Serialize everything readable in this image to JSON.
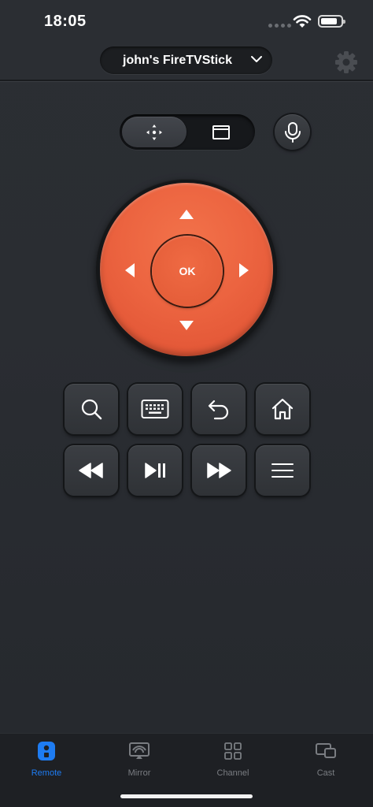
{
  "status_bar": {
    "time": "18:05"
  },
  "header": {
    "device_name": "john's FireTVStick",
    "icons": {
      "chevron": "chevron-down-icon",
      "settings": "gear-icon"
    }
  },
  "mode_toggle": {
    "selected": "dpad",
    "options": [
      "dpad",
      "touchpad"
    ]
  },
  "dpad": {
    "ok_label": "OK",
    "color": "#ec6440"
  },
  "controls": {
    "row1": [
      "search",
      "keyboard",
      "back",
      "home"
    ],
    "row2": [
      "rewind",
      "play-pause",
      "fast-forward",
      "menu"
    ]
  },
  "tab_bar": {
    "active_color": "#1e7cf2",
    "tabs": [
      {
        "label": "Remote",
        "icon": "remote-icon",
        "active": true
      },
      {
        "label": "Mirror",
        "icon": "mirror-icon",
        "active": false
      },
      {
        "label": "Channel",
        "icon": "grid-icon",
        "active": false
      },
      {
        "label": "Cast",
        "icon": "cast-icon",
        "active": false
      }
    ]
  }
}
